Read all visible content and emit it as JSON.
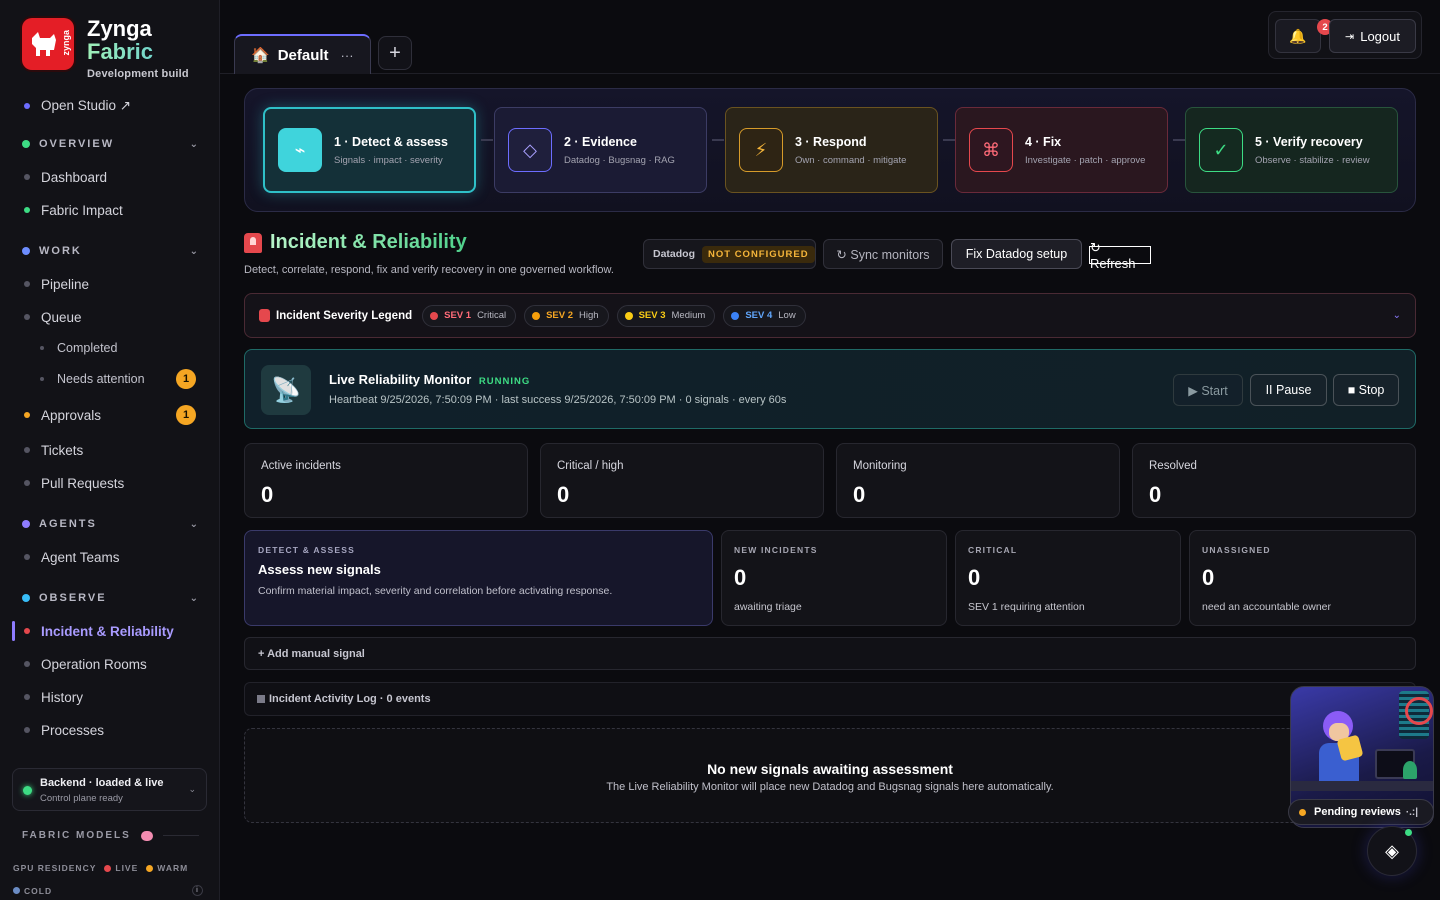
{
  "brand": {
    "name_line1": "Zynga",
    "name_line2": "Fabric",
    "subtitle": "Development build",
    "logo_word": "zynga"
  },
  "sidebar": {
    "open_studio": "Open Studio ↗",
    "sections": {
      "overview": "OVERVIEW",
      "work": "WORK",
      "agents": "AGENTS",
      "observe": "OBSERVE"
    },
    "items": {
      "dashboard": "Dashboard",
      "fabric_impact": "Fabric Impact",
      "pipeline": "Pipeline",
      "queue": "Queue",
      "completed": "Completed",
      "needs_attention": "Needs attention",
      "needs_attention_count": "1",
      "approvals": "Approvals",
      "approvals_count": "1",
      "tickets": "Tickets",
      "pull_requests": "Pull Requests",
      "agent_teams": "Agent Teams",
      "incident_reliability": "Incident & Reliability",
      "operation_rooms": "Operation Rooms",
      "history": "History",
      "processes": "Processes"
    },
    "backend": {
      "title": "Backend · loaded & live",
      "subtitle": "Control plane ready"
    },
    "fabric_models": "FABRIC MODELS",
    "gpu_residency": "GPU RESIDENCY",
    "gpu_live": "LIVE",
    "gpu_warm": "WARM",
    "gpu_cold": "COLD",
    "info_glyph": "i"
  },
  "topbar": {
    "tab_label": "Default",
    "tab_more": "···",
    "add_tab": "+",
    "notif_count": "2",
    "logout": "Logout"
  },
  "workflow": {
    "steps": [
      {
        "title": "1 · Detect & assess",
        "sub": "Signals · impact · severity",
        "icon": "⌁"
      },
      {
        "title": "2 · Evidence",
        "sub": "Datadog · Bugsnag · RAG",
        "icon": "◇"
      },
      {
        "title": "3 · Respond",
        "sub": "Own · command · mitigate",
        "icon": "⚡"
      },
      {
        "title": "4 · Fix",
        "sub": "Investigate · patch · approve",
        "icon": "⌘"
      },
      {
        "title": "5 · Verify recovery",
        "sub": "Observe · stabilize · review",
        "icon": "✓"
      }
    ]
  },
  "page": {
    "title": "Incident & Reliability",
    "subtitle": "Detect, correlate, respond, fix and verify recovery in one governed workflow.",
    "datadog_label": "Datadog",
    "datadog_status": "NOT CONFIGURED",
    "sync_monitors": "↻ Sync monitors",
    "fix_datadog": "Fix Datadog setup",
    "refresh": "↻ Refresh"
  },
  "legend": {
    "title": "Incident Severity Legend",
    "items": [
      {
        "level": "SEV 1",
        "name": "Critical",
        "color": "#e5484d"
      },
      {
        "level": "SEV 2",
        "name": "High",
        "color": "#f59e0b"
      },
      {
        "level": "SEV 3",
        "name": "Medium",
        "color": "#facc15"
      },
      {
        "level": "SEV 4",
        "name": "Low",
        "color": "#3b82f6"
      }
    ]
  },
  "monitor": {
    "title": "Live Reliability Monitor",
    "status": "RUNNING",
    "details": "Heartbeat 9/25/2026, 7:50:09 PM · last success 9/25/2026, 7:50:09 PM · 0 signals · every 60s",
    "start": "▶ Start",
    "pause": "II Pause",
    "stop": "■ Stop"
  },
  "stats": [
    {
      "label": "Active incidents",
      "value": "0"
    },
    {
      "label": "Critical / high",
      "value": "0"
    },
    {
      "label": "Monitoring",
      "value": "0"
    },
    {
      "label": "Resolved",
      "value": "0"
    }
  ],
  "assess": {
    "kicker": "DETECT & ASSESS",
    "title": "Assess new signals",
    "desc": "Confirm material impact, severity and correlation before activating response."
  },
  "minis": [
    {
      "kicker": "NEW INCIDENTS",
      "value": "0",
      "desc": "awaiting triage"
    },
    {
      "kicker": "CRITICAL",
      "value": "0",
      "desc": "SEV 1 requiring attention"
    },
    {
      "kicker": "UNASSIGNED",
      "value": "0",
      "desc": "need an accountable owner"
    }
  ],
  "add_manual": "+ Add manual signal",
  "activity_log": "Incident Activity Log · 0 events",
  "empty": {
    "title": "No new signals awaiting assessment",
    "desc": "The Live Reliability Monitor will place new Datadog and Bugsnag signals here automatically."
  },
  "pending": {
    "label": "Pending reviews",
    "more": "·.:|"
  },
  "fab_icon": "◈",
  "colors": {
    "accent": "#8f7cff",
    "success": "#3ddc84",
    "danger": "#e5484d",
    "warning": "#f5a623"
  }
}
